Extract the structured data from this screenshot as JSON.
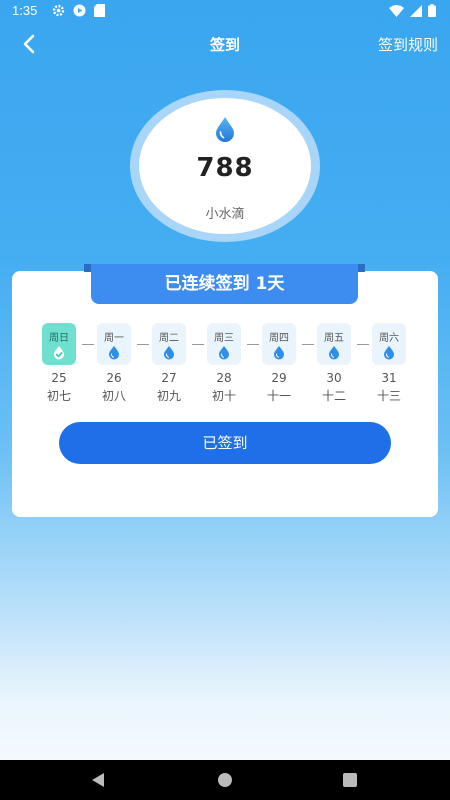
{
  "status_bar": {
    "time": "1:35",
    "left_icons": [
      "gear-icon",
      "play-icon",
      "sd-card-icon"
    ],
    "right_icons": [
      "wifi-icon",
      "signal-icon",
      "battery-icon"
    ]
  },
  "header": {
    "title": "签到",
    "rules_label": "签到规则"
  },
  "points": {
    "value": "788",
    "label": "小水滴"
  },
  "streak_banner": "已连续签到  1天",
  "days": [
    {
      "weekday": "周日",
      "date": "25",
      "lunar": "初七",
      "checked": true
    },
    {
      "weekday": "周一",
      "date": "26",
      "lunar": "初八",
      "checked": false
    },
    {
      "weekday": "周二",
      "date": "27",
      "lunar": "初九",
      "checked": false
    },
    {
      "weekday": "周三",
      "date": "28",
      "lunar": "初十",
      "checked": false
    },
    {
      "weekday": "周四",
      "date": "29",
      "lunar": "十一",
      "checked": false
    },
    {
      "weekday": "周五",
      "date": "30",
      "lunar": "十二",
      "checked": false
    },
    {
      "weekday": "周六",
      "date": "31",
      "lunar": "十三",
      "checked": false
    }
  ],
  "signin_button_label": "已签到",
  "colors": {
    "accent": "#3d8df0",
    "button": "#1f6fe8",
    "checked_day": "#6fe0cf",
    "drop": "#2f8fe6"
  }
}
